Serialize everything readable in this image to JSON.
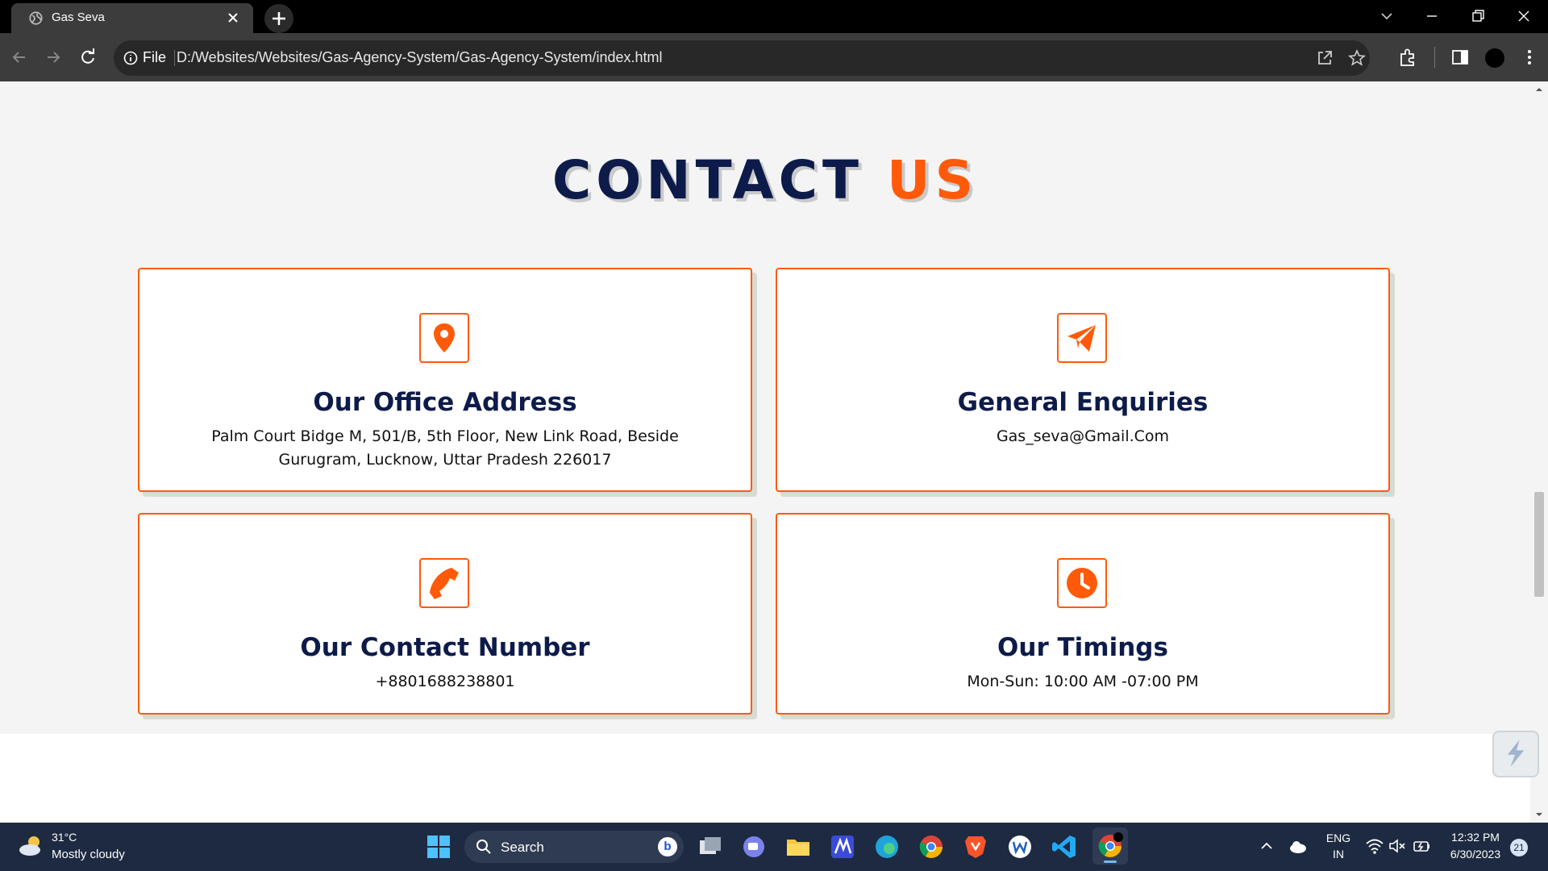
{
  "browser": {
    "tab_title": "Gas Seva",
    "file_label": "File",
    "url": "D:/Websites/Websites/Gas-Agency-System/Gas-Agency-System/index.html"
  },
  "section": {
    "heading_main": "CONTACT",
    "heading_accent": "US",
    "accent_color": "#ff5a09",
    "heading_color": "#0d1b4a"
  },
  "cards": [
    {
      "icon": "map-pin-icon",
      "title": "Our Office Address",
      "text": "Palm Court Bidge M, 501/B, 5th Floor, New Link Road, Beside Gurugram, Lucknow, Uttar Pradesh 226017"
    },
    {
      "icon": "paper-plane-icon",
      "title": "General Enquiries",
      "text": "Gas_seva@Gmail.Com"
    },
    {
      "icon": "phone-icon",
      "title": "Our Contact Number",
      "text": "+8801688238801"
    },
    {
      "icon": "clock-icon",
      "title": "Our Timings",
      "text": "Mon-Sun: 10:00 AM -07:00 PM"
    }
  ],
  "taskbar": {
    "temperature": "31°C",
    "condition": "Mostly cloudy",
    "search_label": "Search",
    "bing_glyph": "b",
    "lang_top": "ENG",
    "lang_bottom": "IN",
    "time": "12:32 PM",
    "date": "6/30/2023",
    "notification_count": "21"
  }
}
